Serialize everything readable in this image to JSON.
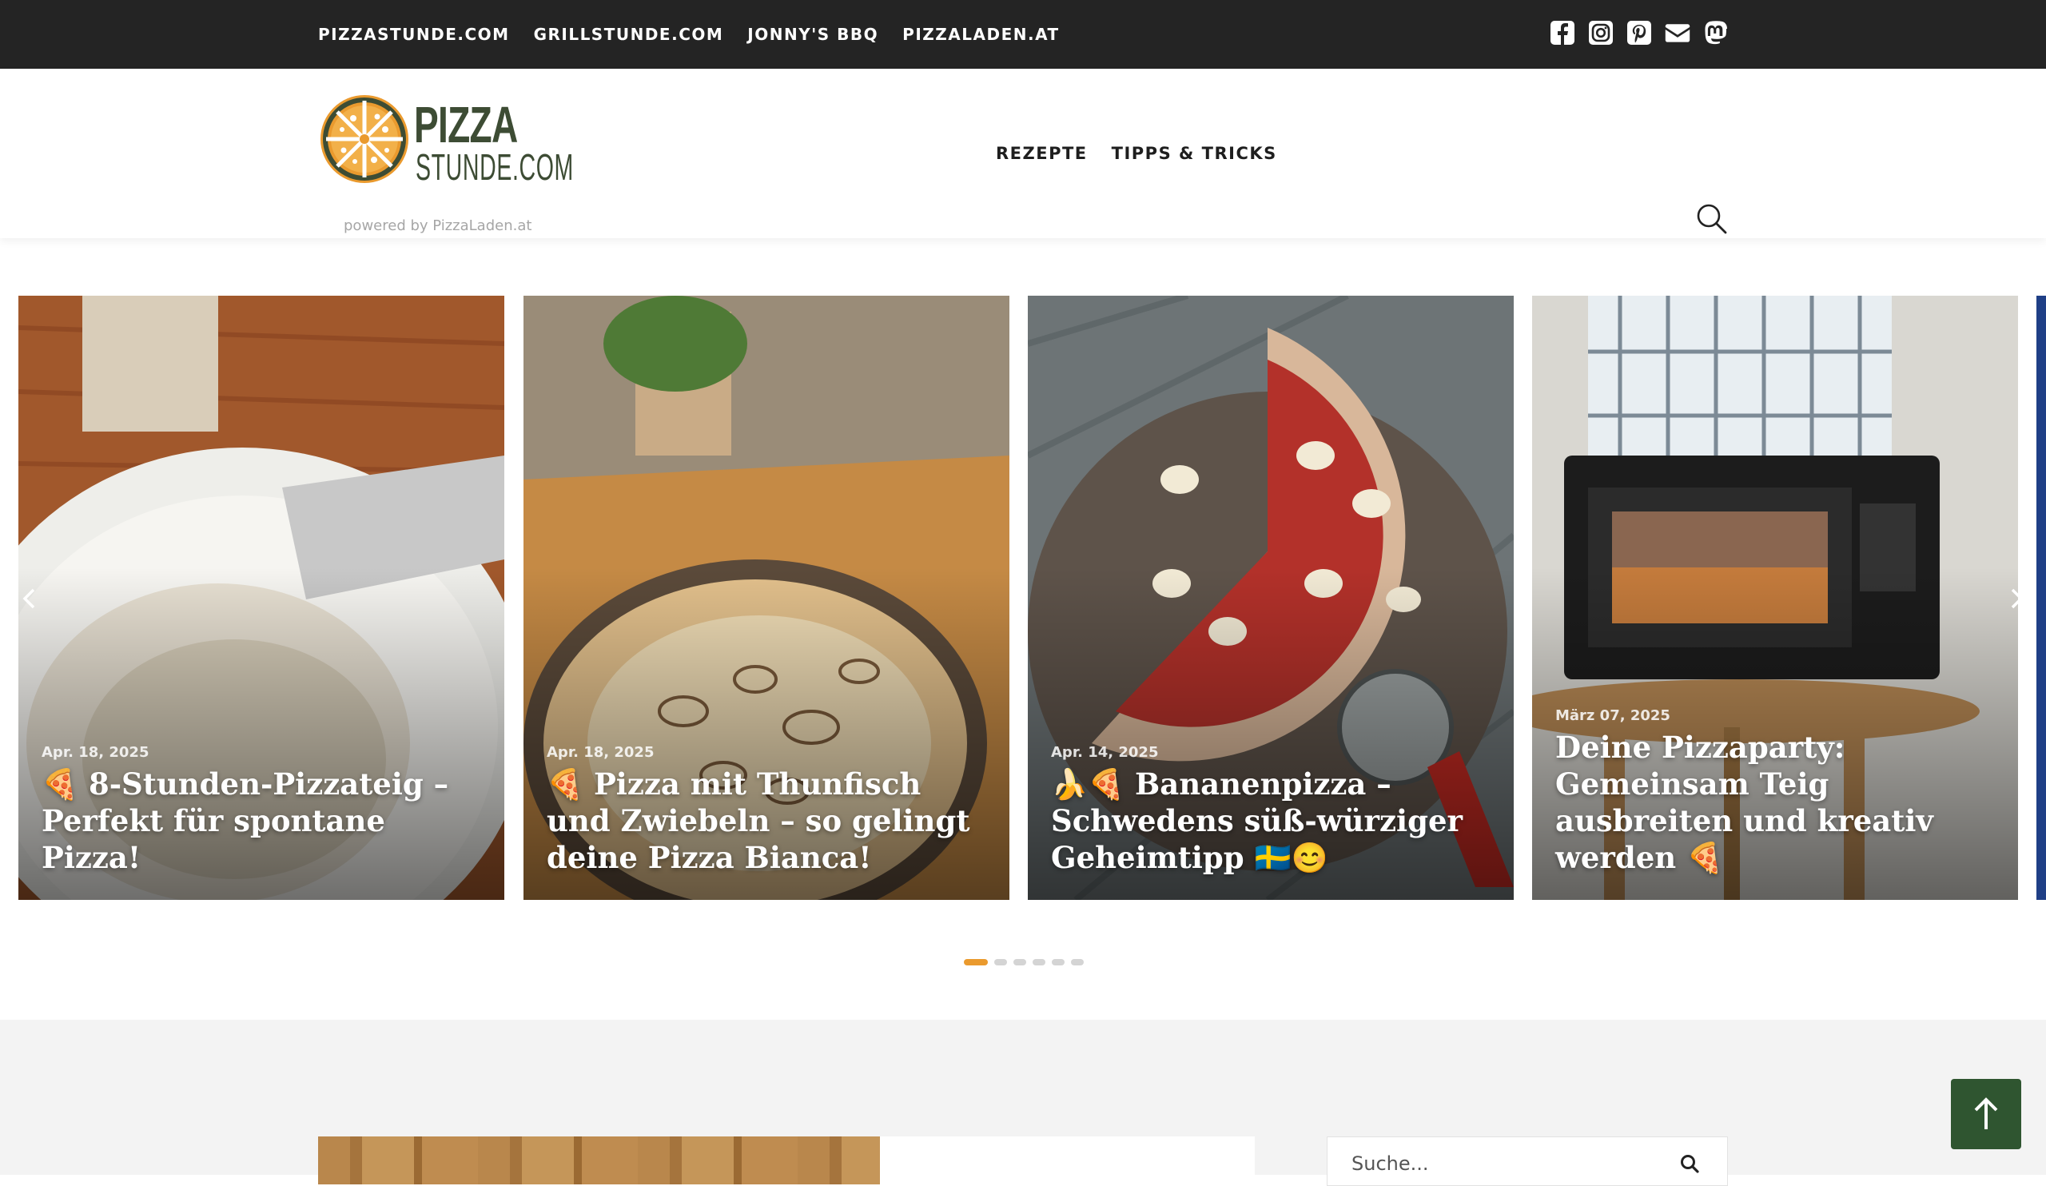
{
  "topbar": {
    "links": [
      "PIZZASTUNDE.COM",
      "GRILLSTUNDE.COM",
      "JONNY'S BBQ",
      "PIZZALADEN.AT"
    ],
    "social_icons": [
      "facebook-icon",
      "instagram-icon",
      "pinterest-icon",
      "mail-icon",
      "mastodon-icon"
    ]
  },
  "header": {
    "logo_word1": "PIZZA",
    "logo_word2": "STUNDE.COM",
    "powered": "powered by PizzaLaden.at",
    "nav": [
      "REZEPTE",
      "TIPPS & TRICKS"
    ],
    "search_icon": "search-icon"
  },
  "slider": {
    "slides": [
      {
        "date": "Apr. 18, 2025",
        "title": "🍕 8-Stunden-Pizzateig – Perfekt für spontane Pizza!"
      },
      {
        "date": "Apr. 18, 2025",
        "title": "🍕 Pizza mit Thunfisch und Zwiebeln – so gelingt deine Pizza Bianca!"
      },
      {
        "date": "Apr. 14, 2025",
        "title": "🍌🍕 Bananenpizza – Schwedens süß-würziger Geheimtipp 🇸🇪😊"
      },
      {
        "date": "März 07, 2025",
        "title": "Deine Pizzaparty: Gemeinsam Teig ausbreiten und kreativ werden 🍕"
      }
    ],
    "dots_count": 6,
    "active_dot": 0
  },
  "sidebar": {
    "search_placeholder": "Suche..."
  },
  "colors": {
    "topbar": "#242424",
    "accent": "#ea9a2e",
    "brand_green": "#3d4c34",
    "totop": "#2f5530"
  }
}
